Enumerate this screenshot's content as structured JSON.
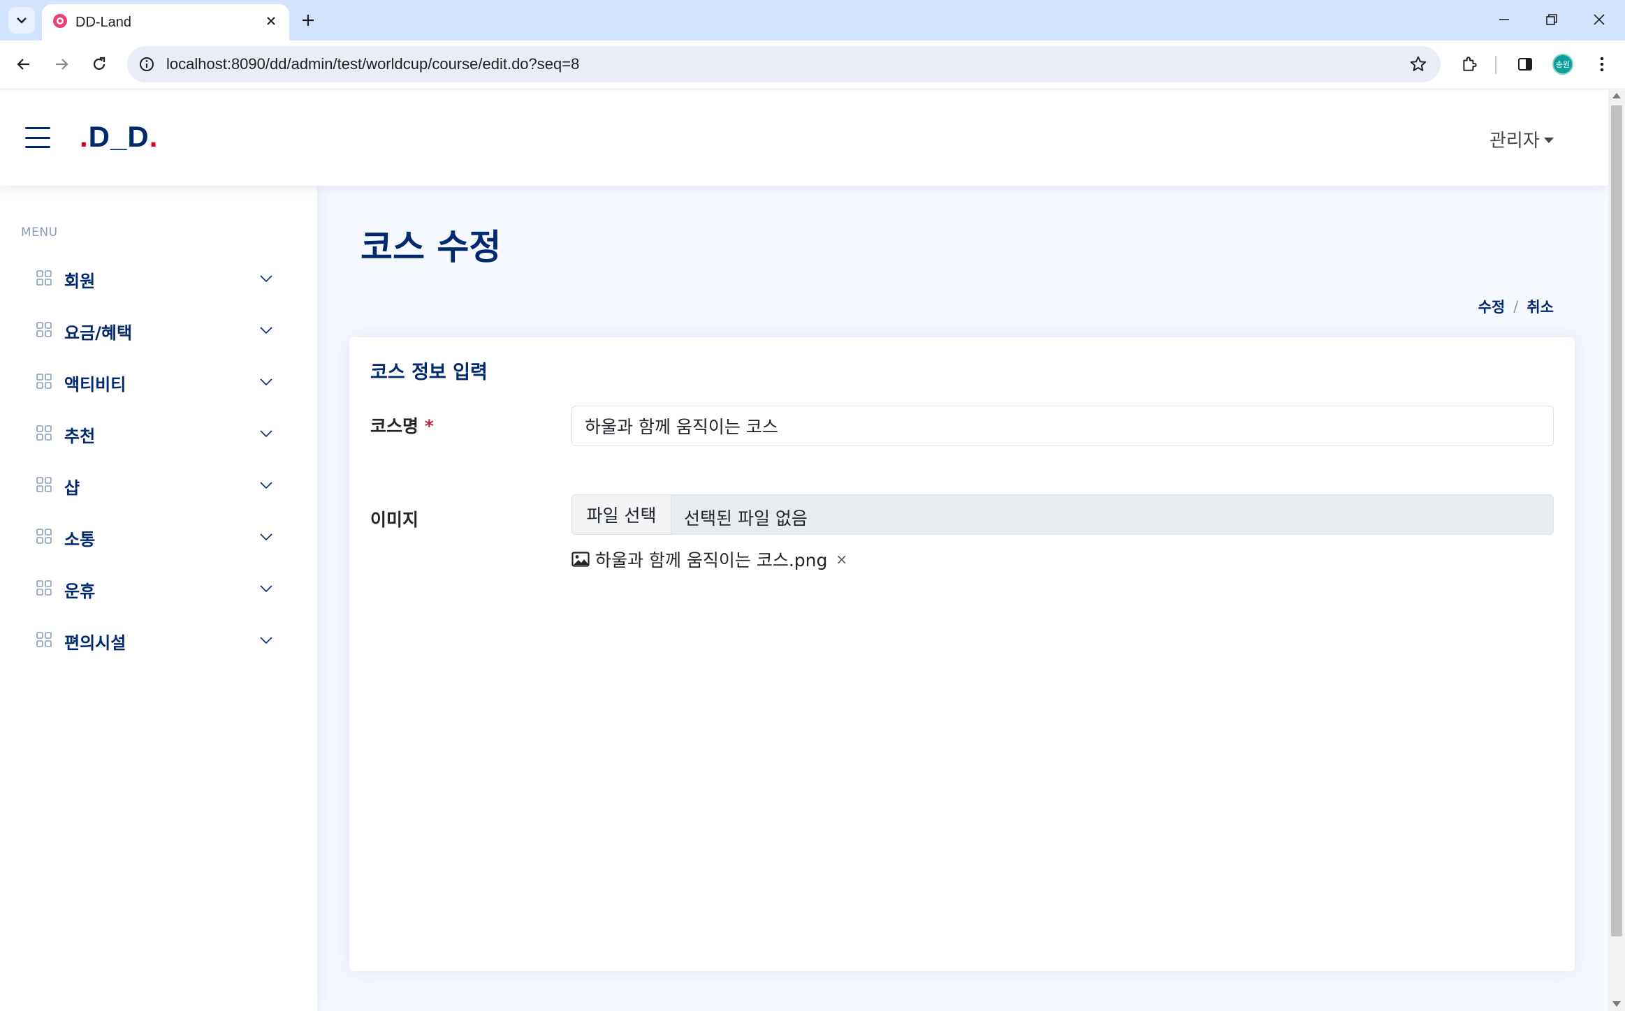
{
  "browser": {
    "tab_title": "DD-Land",
    "url": "localhost:8090/dd/admin/test/worldcup/course/edit.do?seq=8",
    "profile_initials": "송원",
    "icons": [
      "tab-search-icon",
      "close-icon",
      "plus-icon",
      "minimize-icon",
      "restore-icon",
      "window-close-icon",
      "back-arrow-icon",
      "forward-arrow-icon",
      "reload-icon",
      "site-info-icon",
      "star-icon",
      "extensions-icon",
      "side-panel-icon",
      "kebab-menu-icon"
    ]
  },
  "header": {
    "logo": {
      "dot1": ".",
      "text": "D_D",
      "dot2": "."
    },
    "user": "관리자"
  },
  "sidebar": {
    "heading": "MENU",
    "items": [
      {
        "label": "회원"
      },
      {
        "label": "요금/혜택"
      },
      {
        "label": "액티비티"
      },
      {
        "label": "추천"
      },
      {
        "label": "샵"
      },
      {
        "label": "소통"
      },
      {
        "label": "운휴"
      },
      {
        "label": "편의시설"
      }
    ]
  },
  "main": {
    "title": "코스 수정",
    "actions": {
      "edit": "수정",
      "separator": "/",
      "cancel": "취소"
    },
    "card": {
      "title": "코스 정보 입력",
      "name_label": "코스명",
      "required_mark": "*",
      "name_value": "하울과 함께 움직이는 코스",
      "image_label": "이미지",
      "file_button": "파일 선택",
      "file_status": "선택된 파일 없음",
      "attached_file": "하울과 함께 움직이는 코스.png",
      "remove_mark": "×"
    }
  },
  "colors": {
    "primary": "#012970",
    "accent_red": "#d9001b",
    "muted": "#899bbd",
    "page_bg": "#f6f9ff",
    "tabstrip": "#d3e3fd"
  }
}
